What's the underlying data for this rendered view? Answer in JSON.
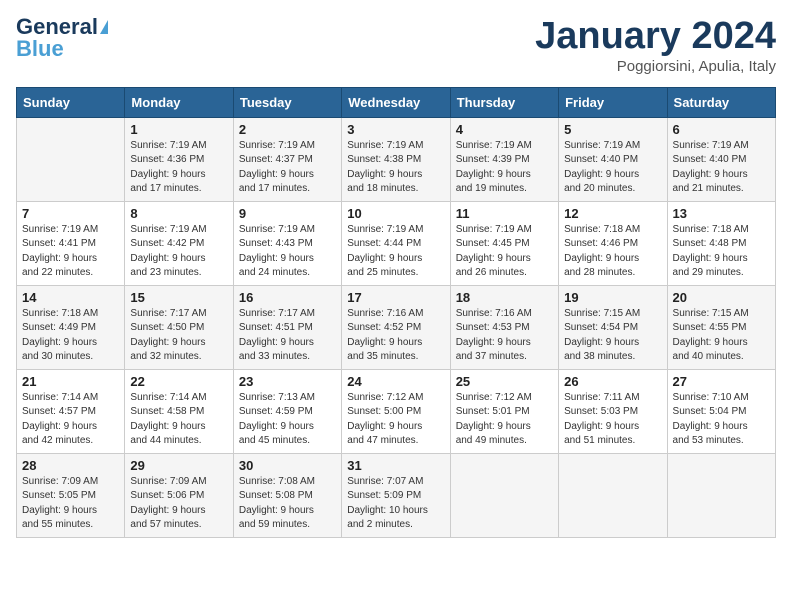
{
  "logo": {
    "part1": "General",
    "part2": "Blue"
  },
  "title": "January 2024",
  "location": "Poggiorsini, Apulia, Italy",
  "days_header": [
    "Sunday",
    "Monday",
    "Tuesday",
    "Wednesday",
    "Thursday",
    "Friday",
    "Saturday"
  ],
  "weeks": [
    [
      {
        "day": "",
        "sunrise": "",
        "sunset": "",
        "daylight": ""
      },
      {
        "day": "1",
        "sunrise": "Sunrise: 7:19 AM",
        "sunset": "Sunset: 4:36 PM",
        "daylight": "Daylight: 9 hours and 17 minutes."
      },
      {
        "day": "2",
        "sunrise": "Sunrise: 7:19 AM",
        "sunset": "Sunset: 4:37 PM",
        "daylight": "Daylight: 9 hours and 17 minutes."
      },
      {
        "day": "3",
        "sunrise": "Sunrise: 7:19 AM",
        "sunset": "Sunset: 4:38 PM",
        "daylight": "Daylight: 9 hours and 18 minutes."
      },
      {
        "day": "4",
        "sunrise": "Sunrise: 7:19 AM",
        "sunset": "Sunset: 4:39 PM",
        "daylight": "Daylight: 9 hours and 19 minutes."
      },
      {
        "day": "5",
        "sunrise": "Sunrise: 7:19 AM",
        "sunset": "Sunset: 4:40 PM",
        "daylight": "Daylight: 9 hours and 20 minutes."
      },
      {
        "day": "6",
        "sunrise": "Sunrise: 7:19 AM",
        "sunset": "Sunset: 4:40 PM",
        "daylight": "Daylight: 9 hours and 21 minutes."
      }
    ],
    [
      {
        "day": "7",
        "sunrise": "Sunrise: 7:19 AM",
        "sunset": "Sunset: 4:41 PM",
        "daylight": "Daylight: 9 hours and 22 minutes."
      },
      {
        "day": "8",
        "sunrise": "Sunrise: 7:19 AM",
        "sunset": "Sunset: 4:42 PM",
        "daylight": "Daylight: 9 hours and 23 minutes."
      },
      {
        "day": "9",
        "sunrise": "Sunrise: 7:19 AM",
        "sunset": "Sunset: 4:43 PM",
        "daylight": "Daylight: 9 hours and 24 minutes."
      },
      {
        "day": "10",
        "sunrise": "Sunrise: 7:19 AM",
        "sunset": "Sunset: 4:44 PM",
        "daylight": "Daylight: 9 hours and 25 minutes."
      },
      {
        "day": "11",
        "sunrise": "Sunrise: 7:19 AM",
        "sunset": "Sunset: 4:45 PM",
        "daylight": "Daylight: 9 hours and 26 minutes."
      },
      {
        "day": "12",
        "sunrise": "Sunrise: 7:18 AM",
        "sunset": "Sunset: 4:46 PM",
        "daylight": "Daylight: 9 hours and 28 minutes."
      },
      {
        "day": "13",
        "sunrise": "Sunrise: 7:18 AM",
        "sunset": "Sunset: 4:48 PM",
        "daylight": "Daylight: 9 hours and 29 minutes."
      }
    ],
    [
      {
        "day": "14",
        "sunrise": "Sunrise: 7:18 AM",
        "sunset": "Sunset: 4:49 PM",
        "daylight": "Daylight: 9 hours and 30 minutes."
      },
      {
        "day": "15",
        "sunrise": "Sunrise: 7:17 AM",
        "sunset": "Sunset: 4:50 PM",
        "daylight": "Daylight: 9 hours and 32 minutes."
      },
      {
        "day": "16",
        "sunrise": "Sunrise: 7:17 AM",
        "sunset": "Sunset: 4:51 PM",
        "daylight": "Daylight: 9 hours and 33 minutes."
      },
      {
        "day": "17",
        "sunrise": "Sunrise: 7:16 AM",
        "sunset": "Sunset: 4:52 PM",
        "daylight": "Daylight: 9 hours and 35 minutes."
      },
      {
        "day": "18",
        "sunrise": "Sunrise: 7:16 AM",
        "sunset": "Sunset: 4:53 PM",
        "daylight": "Daylight: 9 hours and 37 minutes."
      },
      {
        "day": "19",
        "sunrise": "Sunrise: 7:15 AM",
        "sunset": "Sunset: 4:54 PM",
        "daylight": "Daylight: 9 hours and 38 minutes."
      },
      {
        "day": "20",
        "sunrise": "Sunrise: 7:15 AM",
        "sunset": "Sunset: 4:55 PM",
        "daylight": "Daylight: 9 hours and 40 minutes."
      }
    ],
    [
      {
        "day": "21",
        "sunrise": "Sunrise: 7:14 AM",
        "sunset": "Sunset: 4:57 PM",
        "daylight": "Daylight: 9 hours and 42 minutes."
      },
      {
        "day": "22",
        "sunrise": "Sunrise: 7:14 AM",
        "sunset": "Sunset: 4:58 PM",
        "daylight": "Daylight: 9 hours and 44 minutes."
      },
      {
        "day": "23",
        "sunrise": "Sunrise: 7:13 AM",
        "sunset": "Sunset: 4:59 PM",
        "daylight": "Daylight: 9 hours and 45 minutes."
      },
      {
        "day": "24",
        "sunrise": "Sunrise: 7:12 AM",
        "sunset": "Sunset: 5:00 PM",
        "daylight": "Daylight: 9 hours and 47 minutes."
      },
      {
        "day": "25",
        "sunrise": "Sunrise: 7:12 AM",
        "sunset": "Sunset: 5:01 PM",
        "daylight": "Daylight: 9 hours and 49 minutes."
      },
      {
        "day": "26",
        "sunrise": "Sunrise: 7:11 AM",
        "sunset": "Sunset: 5:03 PM",
        "daylight": "Daylight: 9 hours and 51 minutes."
      },
      {
        "day": "27",
        "sunrise": "Sunrise: 7:10 AM",
        "sunset": "Sunset: 5:04 PM",
        "daylight": "Daylight: 9 hours and 53 minutes."
      }
    ],
    [
      {
        "day": "28",
        "sunrise": "Sunrise: 7:09 AM",
        "sunset": "Sunset: 5:05 PM",
        "daylight": "Daylight: 9 hours and 55 minutes."
      },
      {
        "day": "29",
        "sunrise": "Sunrise: 7:09 AM",
        "sunset": "Sunset: 5:06 PM",
        "daylight": "Daylight: 9 hours and 57 minutes."
      },
      {
        "day": "30",
        "sunrise": "Sunrise: 7:08 AM",
        "sunset": "Sunset: 5:08 PM",
        "daylight": "Daylight: 9 hours and 59 minutes."
      },
      {
        "day": "31",
        "sunrise": "Sunrise: 7:07 AM",
        "sunset": "Sunset: 5:09 PM",
        "daylight": "Daylight: 10 hours and 2 minutes."
      },
      {
        "day": "",
        "sunrise": "",
        "sunset": "",
        "daylight": ""
      },
      {
        "day": "",
        "sunrise": "",
        "sunset": "",
        "daylight": ""
      },
      {
        "day": "",
        "sunrise": "",
        "sunset": "",
        "daylight": ""
      }
    ]
  ]
}
